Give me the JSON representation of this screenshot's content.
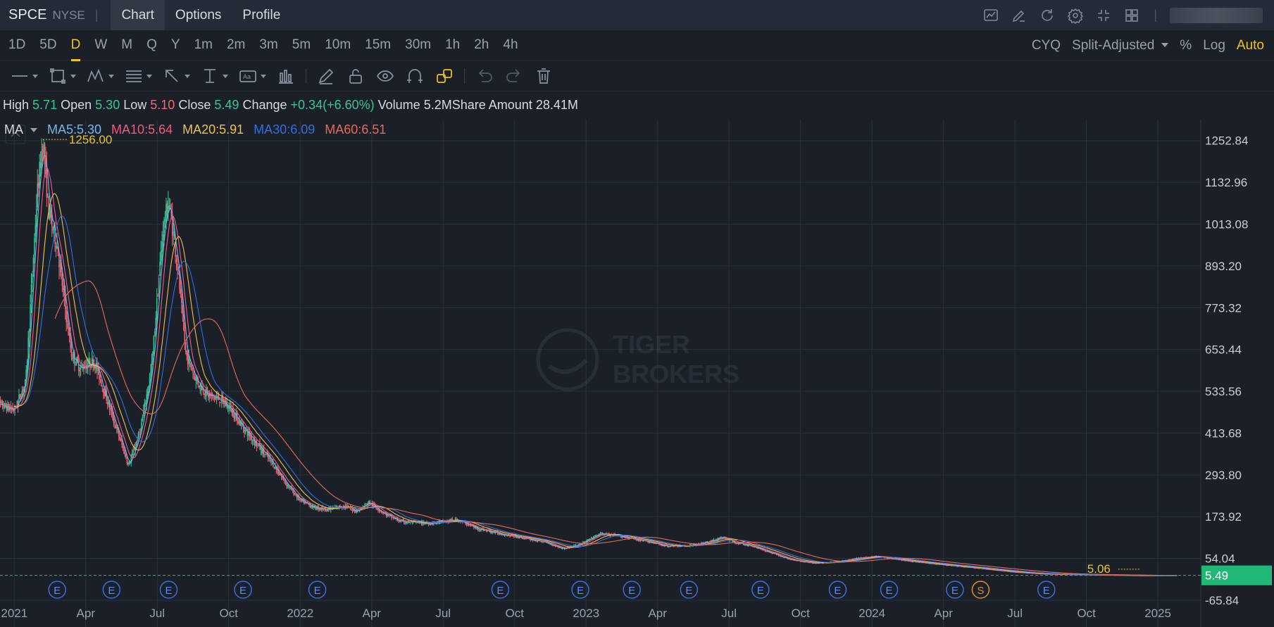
{
  "header": {
    "symbol": "SPCE",
    "exchange": "NYSE",
    "separator": "|",
    "tabs": [
      {
        "label": "Chart"
      },
      {
        "label": "Options"
      },
      {
        "label": "Profile"
      }
    ],
    "active_tab": "Chart",
    "icons": [
      "chart-template-icon",
      "draw-icon",
      "refresh-icon",
      "settings-icon",
      "collapse-icon",
      "layout-grid-icon"
    ]
  },
  "timeframes": {
    "items": [
      "1D",
      "5D",
      "D",
      "W",
      "M",
      "Q",
      "Y",
      "1m",
      "2m",
      "3m",
      "5m",
      "10m",
      "15m",
      "30m",
      "1h",
      "2h",
      "4h"
    ],
    "active": "D",
    "right": {
      "cyq": "CYQ",
      "adjust": "Split-Adjusted",
      "percent": "%",
      "log": "Log",
      "auto": "Auto"
    }
  },
  "toolbar": {
    "tools": [
      "line-tool-icon",
      "rectangle-tool-icon",
      "pattern-tool-icon",
      "fibonacci-tool-icon",
      "arrow-tool-icon",
      "measure-tool-icon",
      "text-tool-icon",
      "bar-tool-icon",
      "pencil-icon",
      "unlock-icon",
      "eye-icon",
      "magnet-icon",
      "link-icon",
      "undo-icon",
      "redo-icon",
      "trash-icon"
    ]
  },
  "quote": {
    "high_label": "High",
    "high": "5.71",
    "open_label": "Open",
    "open": "5.30",
    "low_label": "Low",
    "low": "5.10",
    "close_label": "Close",
    "close": "5.49",
    "change_label": "Change",
    "change": "+0.34(+6.60%)",
    "volume_label": "Volume",
    "volume": "5.2M",
    "amount_label": "Share Amount",
    "amount": "28.41M"
  },
  "ma": {
    "label": "MA",
    "items": [
      {
        "text": "MA5:5.30",
        "color": "#6fb6f0"
      },
      {
        "text": "MA10:5.64",
        "color": "#ec5c82"
      },
      {
        "text": "MA20:5.91",
        "color": "#f0c04a"
      },
      {
        "text": "MA30:6.09",
        "color": "#2f6fe0"
      },
      {
        "text": "MA60:6.51",
        "color": "#e8695a"
      }
    ]
  },
  "chart_data": {
    "type": "candlestick",
    "ylim": [
      -65.84,
      1312.84
    ],
    "y_ticks": [
      1252.84,
      1132.96,
      1013.08,
      893.2,
      773.32,
      653.44,
      533.56,
      413.68,
      293.8,
      173.92,
      54.04,
      -65.84
    ],
    "y_tick_labels": [
      "1252.84",
      "1132.96",
      "1013.08",
      "893.20",
      "773.32",
      "653.44",
      "533.56",
      "413.68",
      "293.80",
      "173.92",
      "54.04",
      "-65.84"
    ],
    "x_tick_labels": [
      "2021",
      "Apr",
      "Jul",
      "Oct",
      "2022",
      "Apr",
      "Jul",
      "Oct",
      "2023",
      "Apr",
      "Jul",
      "Oct",
      "2024",
      "Apr",
      "Jul",
      "Oct",
      "2025"
    ],
    "max_label": "1256.00",
    "max_value": 1256.0,
    "min_label": "5.06",
    "min_value": 5.06,
    "last_price_label": "5.49",
    "last_price": 5.49,
    "grid": true,
    "price_anchors": [
      [
        2020.93,
        500
      ],
      [
        2021.0,
        480
      ],
      [
        2021.04,
        560
      ],
      [
        2021.08,
        1100
      ],
      [
        2021.1,
        1256
      ],
      [
        2021.12,
        1050
      ],
      [
        2021.15,
        950
      ],
      [
        2021.18,
        760
      ],
      [
        2021.2,
        640
      ],
      [
        2021.23,
        600
      ],
      [
        2021.28,
        620
      ],
      [
        2021.32,
        520
      ],
      [
        2021.36,
        420
      ],
      [
        2021.4,
        320
      ],
      [
        2021.44,
        420
      ],
      [
        2021.48,
        600
      ],
      [
        2021.5,
        800
      ],
      [
        2021.52,
        1000
      ],
      [
        2021.54,
        1080
      ],
      [
        2021.57,
        900
      ],
      [
        2021.6,
        640
      ],
      [
        2021.64,
        560
      ],
      [
        2021.68,
        520
      ],
      [
        2021.72,
        510
      ],
      [
        2021.76,
        480
      ],
      [
        2021.8,
        430
      ],
      [
        2021.85,
        380
      ],
      [
        2021.9,
        330
      ],
      [
        2021.95,
        270
      ],
      [
        2022.0,
        220
      ],
      [
        2022.05,
        200
      ],
      [
        2022.1,
        195
      ],
      [
        2022.15,
        205
      ],
      [
        2022.2,
        190
      ],
      [
        2022.24,
        215
      ],
      [
        2022.3,
        180
      ],
      [
        2022.35,
        160
      ],
      [
        2022.45,
        155
      ],
      [
        2022.55,
        165
      ],
      [
        2022.62,
        140
      ],
      [
        2022.7,
        125
      ],
      [
        2022.8,
        110
      ],
      [
        2022.86,
        100
      ],
      [
        2022.92,
        82
      ],
      [
        2022.98,
        95
      ],
      [
        2023.05,
        125
      ],
      [
        2023.12,
        118
      ],
      [
        2023.2,
        105
      ],
      [
        2023.28,
        90
      ],
      [
        2023.35,
        90
      ],
      [
        2023.42,
        100
      ],
      [
        2023.48,
        115
      ],
      [
        2023.52,
        100
      ],
      [
        2023.58,
        90
      ],
      [
        2023.65,
        70
      ],
      [
        2023.72,
        50
      ],
      [
        2023.8,
        40
      ],
      [
        2023.88,
        45
      ],
      [
        2023.95,
        55
      ],
      [
        2024.02,
        60
      ],
      [
        2024.1,
        50
      ],
      [
        2024.2,
        40
      ],
      [
        2024.3,
        32
      ],
      [
        2024.4,
        24
      ],
      [
        2024.5,
        15
      ],
      [
        2024.6,
        10
      ],
      [
        2024.7,
        8
      ],
      [
        2024.8,
        7
      ],
      [
        2024.88,
        6
      ],
      [
        2024.95,
        5.06
      ],
      [
        2025.02,
        5.2
      ],
      [
        2025.07,
        5.49
      ]
    ],
    "earnings_markers": [
      {
        "x": 2021.15,
        "label": "E"
      },
      {
        "x": 2021.34,
        "label": "E"
      },
      {
        "x": 2021.54,
        "label": "E"
      },
      {
        "x": 2021.8,
        "label": "E"
      },
      {
        "x": 2022.06,
        "label": "E"
      },
      {
        "x": 2022.7,
        "label": "E"
      },
      {
        "x": 2022.98,
        "label": "E"
      },
      {
        "x": 2023.16,
        "label": "E"
      },
      {
        "x": 2023.36,
        "label": "E"
      },
      {
        "x": 2023.61,
        "label": "E"
      },
      {
        "x": 2023.88,
        "label": "E"
      },
      {
        "x": 2024.06,
        "label": "E"
      },
      {
        "x": 2024.29,
        "label": "E"
      },
      {
        "x": 2024.61,
        "label": "E"
      }
    ],
    "split_markers": [
      {
        "x": 2024.38,
        "label": "S"
      }
    ],
    "series": [
      {
        "name": "MA5",
        "color": "#6fb6f0",
        "window": 5
      },
      {
        "name": "MA10",
        "color": "#ec5c82",
        "window": 10
      },
      {
        "name": "MA20",
        "color": "#f0c04a",
        "window": 20
      },
      {
        "name": "MA30",
        "color": "#2f6fe0",
        "window": 30
      },
      {
        "name": "MA60",
        "color": "#e8695a",
        "window": 60
      }
    ],
    "x_tick_positions": [
      2021.0,
      2021.25,
      2021.5,
      2021.75,
      2022.0,
      2022.25,
      2022.5,
      2022.75,
      2023.0,
      2023.25,
      2023.5,
      2023.75,
      2024.0,
      2024.25,
      2024.5,
      2024.75,
      2025.0
    ],
    "xlim": [
      2020.95,
      2025.15
    ],
    "colors": {
      "up": "#35c691",
      "down": "#f16676",
      "last_bg": "#1fb877",
      "max": "#f0c419",
      "grid": "#2a303a"
    }
  }
}
